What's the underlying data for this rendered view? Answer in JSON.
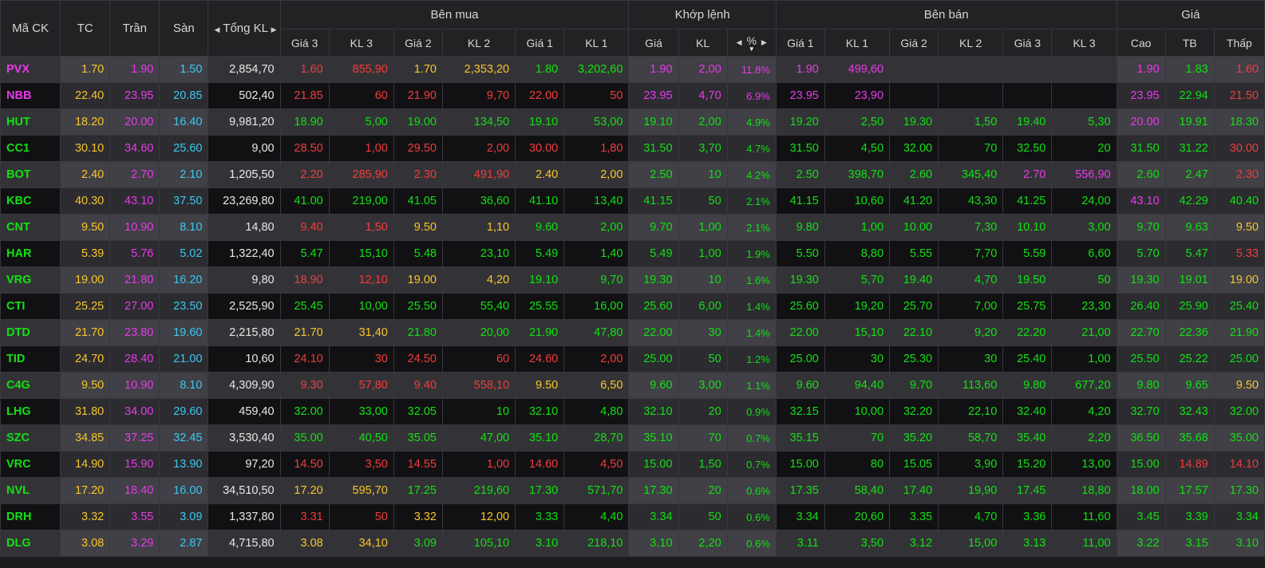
{
  "headers": {
    "top": {
      "symbol": "Mã CK",
      "ref": "TC",
      "ceil": "Trần",
      "floor": "Sàn",
      "total": "Tổng KL",
      "buy": "Bên mua",
      "match": "Khớp lệnh",
      "sell": "Bên bán",
      "price": "Giá"
    },
    "sub": {
      "p3": "Giá 3",
      "v3": "KL 3",
      "p2": "Giá 2",
      "v2": "KL 2",
      "p1": "Giá 1",
      "v1": "KL 1",
      "mp": "Giá",
      "mv": "KL",
      "pct": "%",
      "sp1": "Giá 1",
      "sv1": "KL 1",
      "sp2": "Giá 2",
      "sv2": "KL 2",
      "sp3": "Giá 3",
      "sv3": "KL 3",
      "high": "Cao",
      "avg": "TB",
      "low": "Thấp"
    }
  },
  "colors": {
    "r": "#f7c52b",
    "u": "#12e012",
    "d": "#f13c3c",
    "c": "#e83ae8",
    "f": "#3dc7ee"
  },
  "rows": [
    {
      "sym": [
        "PVX",
        "c"
      ],
      "ref": "1.70",
      "ceil": "1.90",
      "floor": "1.50",
      "total": "2,854,70",
      "b3": [
        "1.60",
        "855,90",
        "d"
      ],
      "b2": [
        "1.70",
        "2,353,20",
        "r"
      ],
      "b1": [
        "1.80",
        "3,202,60",
        "u"
      ],
      "m": [
        "1.90",
        "2,00",
        "c"
      ],
      "pct": "11.8%",
      "s1": [
        "1.90",
        "499,60",
        "c"
      ],
      "s2": [
        "",
        "",
        "u"
      ],
      "s3": [
        "",
        "",
        "u"
      ],
      "hi": [
        "1.90",
        "c"
      ],
      "avg": [
        "1.83",
        "u"
      ],
      "lo": [
        "1.60",
        "d"
      ]
    },
    {
      "sym": [
        "NBB",
        "c"
      ],
      "ref": "22.40",
      "ceil": "23.95",
      "floor": "20.85",
      "total": "502,40",
      "b3": [
        "21.85",
        "60",
        "d"
      ],
      "b2": [
        "21.90",
        "9,70",
        "d"
      ],
      "b1": [
        "22.00",
        "50",
        "d"
      ],
      "m": [
        "23.95",
        "4,70",
        "c"
      ],
      "pct": "6.9%",
      "s1": [
        "23.95",
        "23,90",
        "c"
      ],
      "s2": [
        "",
        "",
        "u"
      ],
      "s3": [
        "",
        "",
        "u"
      ],
      "hi": [
        "23.95",
        "c"
      ],
      "avg": [
        "22.94",
        "u"
      ],
      "lo": [
        "21.50",
        "d"
      ]
    },
    {
      "sym": [
        "HUT",
        "u"
      ],
      "ref": "18.20",
      "ceil": "20.00",
      "floor": "16.40",
      "total": "9,981,20",
      "b3": [
        "18.90",
        "5,00",
        "u"
      ],
      "b2": [
        "19.00",
        "134,50",
        "u"
      ],
      "b1": [
        "19.10",
        "53,00",
        "u"
      ],
      "m": [
        "19.10",
        "2,00",
        "u"
      ],
      "pct": "4.9%",
      "s1": [
        "19.20",
        "2,50",
        "u"
      ],
      "s2": [
        "19.30",
        "1,50",
        "u"
      ],
      "s3": [
        "19.40",
        "5,30",
        "u"
      ],
      "hi": [
        "20.00",
        "c"
      ],
      "avg": [
        "19.91",
        "u"
      ],
      "lo": [
        "18.30",
        "u"
      ]
    },
    {
      "sym": [
        "CC1",
        "u"
      ],
      "ref": "30.10",
      "ceil": "34.60",
      "floor": "25.60",
      "total": "9,00",
      "b3": [
        "28.50",
        "1,00",
        "d"
      ],
      "b2": [
        "29.50",
        "2,00",
        "d"
      ],
      "b1": [
        "30.00",
        "1,80",
        "d"
      ],
      "m": [
        "31.50",
        "3,70",
        "u"
      ],
      "pct": "4.7%",
      "s1": [
        "31.50",
        "4,50",
        "u"
      ],
      "s2": [
        "32.00",
        "70",
        "u"
      ],
      "s3": [
        "32.50",
        "20",
        "u"
      ],
      "hi": [
        "31.50",
        "u"
      ],
      "avg": [
        "31.22",
        "u"
      ],
      "lo": [
        "30.00",
        "d"
      ]
    },
    {
      "sym": [
        "BOT",
        "u"
      ],
      "ref": "2.40",
      "ceil": "2.70",
      "floor": "2.10",
      "total": "1,205,50",
      "b3": [
        "2.20",
        "285,90",
        "d"
      ],
      "b2": [
        "2.30",
        "491,90",
        "d"
      ],
      "b1": [
        "2.40",
        "2,00",
        "r"
      ],
      "m": [
        "2.50",
        "10",
        "u"
      ],
      "pct": "4.2%",
      "s1": [
        "2.50",
        "398,70",
        "u"
      ],
      "s2": [
        "2.60",
        "345,40",
        "u"
      ],
      "s3": [
        "2.70",
        "556,90",
        "c"
      ],
      "hi": [
        "2.60",
        "u"
      ],
      "avg": [
        "2.47",
        "u"
      ],
      "lo": [
        "2.30",
        "d"
      ]
    },
    {
      "sym": [
        "KBC",
        "u"
      ],
      "ref": "40.30",
      "ceil": "43.10",
      "floor": "37.50",
      "total": "23,269,80",
      "b3": [
        "41.00",
        "219,00",
        "u"
      ],
      "b2": [
        "41.05",
        "36,60",
        "u"
      ],
      "b1": [
        "41.10",
        "13,40",
        "u"
      ],
      "m": [
        "41.15",
        "50",
        "u"
      ],
      "pct": "2.1%",
      "s1": [
        "41.15",
        "10,60",
        "u"
      ],
      "s2": [
        "41.20",
        "43,30",
        "u"
      ],
      "s3": [
        "41.25",
        "24,00",
        "u"
      ],
      "hi": [
        "43.10",
        "c"
      ],
      "avg": [
        "42.29",
        "u"
      ],
      "lo": [
        "40.40",
        "u"
      ]
    },
    {
      "sym": [
        "CNT",
        "u"
      ],
      "ref": "9.50",
      "ceil": "10.90",
      "floor": "8.10",
      "total": "14,80",
      "b3": [
        "9.40",
        "1,50",
        "d"
      ],
      "b2": [
        "9.50",
        "1,10",
        "r"
      ],
      "b1": [
        "9.60",
        "2,00",
        "u"
      ],
      "m": [
        "9.70",
        "1,00",
        "u"
      ],
      "pct": "2.1%",
      "s1": [
        "9.80",
        "1,00",
        "u"
      ],
      "s2": [
        "10.00",
        "7,30",
        "u"
      ],
      "s3": [
        "10.10",
        "3,00",
        "u"
      ],
      "hi": [
        "9.70",
        "u"
      ],
      "avg": [
        "9.63",
        "u"
      ],
      "lo": [
        "9.50",
        "r"
      ]
    },
    {
      "sym": [
        "HAR",
        "u"
      ],
      "ref": "5.39",
      "ceil": "5.76",
      "floor": "5.02",
      "total": "1,322,40",
      "b3": [
        "5.47",
        "15,10",
        "u"
      ],
      "b2": [
        "5.48",
        "23,10",
        "u"
      ],
      "b1": [
        "5.49",
        "1,40",
        "u"
      ],
      "m": [
        "5.49",
        "1,00",
        "u"
      ],
      "pct": "1.9%",
      "s1": [
        "5.50",
        "8,80",
        "u"
      ],
      "s2": [
        "5.55",
        "7,70",
        "u"
      ],
      "s3": [
        "5.59",
        "6,60",
        "u"
      ],
      "hi": [
        "5.70",
        "u"
      ],
      "avg": [
        "5.47",
        "u"
      ],
      "lo": [
        "5.33",
        "d"
      ]
    },
    {
      "sym": [
        "VRG",
        "u"
      ],
      "ref": "19.00",
      "ceil": "21.80",
      "floor": "16.20",
      "total": "9,80",
      "b3": [
        "18.90",
        "12,10",
        "d"
      ],
      "b2": [
        "19.00",
        "4,20",
        "r"
      ],
      "b1": [
        "19.10",
        "9,70",
        "u"
      ],
      "m": [
        "19.30",
        "10",
        "u"
      ],
      "pct": "1.6%",
      "s1": [
        "19.30",
        "5,70",
        "u"
      ],
      "s2": [
        "19.40",
        "4,70",
        "u"
      ],
      "s3": [
        "19.50",
        "50",
        "u"
      ],
      "hi": [
        "19.30",
        "u"
      ],
      "avg": [
        "19.01",
        "u"
      ],
      "lo": [
        "19.00",
        "r"
      ]
    },
    {
      "sym": [
        "CTI",
        "u"
      ],
      "ref": "25.25",
      "ceil": "27.00",
      "floor": "23.50",
      "total": "2,525,90",
      "b3": [
        "25.45",
        "10,00",
        "u"
      ],
      "b2": [
        "25.50",
        "55,40",
        "u"
      ],
      "b1": [
        "25.55",
        "16,00",
        "u"
      ],
      "m": [
        "25.60",
        "6,00",
        "u"
      ],
      "pct": "1.4%",
      "s1": [
        "25.60",
        "19,20",
        "u"
      ],
      "s2": [
        "25.70",
        "7,00",
        "u"
      ],
      "s3": [
        "25.75",
        "23,30",
        "u"
      ],
      "hi": [
        "26.40",
        "u"
      ],
      "avg": [
        "25.90",
        "u"
      ],
      "lo": [
        "25.40",
        "u"
      ]
    },
    {
      "sym": [
        "DTD",
        "u"
      ],
      "ref": "21.70",
      "ceil": "23.80",
      "floor": "19.60",
      "total": "2,215,80",
      "b3": [
        "21.70",
        "31,40",
        "r"
      ],
      "b2": [
        "21.80",
        "20,00",
        "u"
      ],
      "b1": [
        "21.90",
        "47,80",
        "u"
      ],
      "m": [
        "22.00",
        "30",
        "u"
      ],
      "pct": "1.4%",
      "s1": [
        "22.00",
        "15,10",
        "u"
      ],
      "s2": [
        "22.10",
        "9,20",
        "u"
      ],
      "s3": [
        "22.20",
        "21,00",
        "u"
      ],
      "hi": [
        "22.70",
        "u"
      ],
      "avg": [
        "22.36",
        "u"
      ],
      "lo": [
        "21.90",
        "u"
      ]
    },
    {
      "sym": [
        "TID",
        "u"
      ],
      "ref": "24.70",
      "ceil": "28.40",
      "floor": "21.00",
      "total": "10,60",
      "b3": [
        "24.10",
        "30",
        "d"
      ],
      "b2": [
        "24.50",
        "60",
        "d"
      ],
      "b1": [
        "24.60",
        "2,00",
        "d"
      ],
      "m": [
        "25.00",
        "50",
        "u"
      ],
      "pct": "1.2%",
      "s1": [
        "25.00",
        "30",
        "u"
      ],
      "s2": [
        "25.30",
        "30",
        "u"
      ],
      "s3": [
        "25.40",
        "1,00",
        "u"
      ],
      "hi": [
        "25.50",
        "u"
      ],
      "avg": [
        "25.22",
        "u"
      ],
      "lo": [
        "25.00",
        "u"
      ]
    },
    {
      "sym": [
        "C4G",
        "u"
      ],
      "ref": "9.50",
      "ceil": "10.90",
      "floor": "8.10",
      "total": "4,309,90",
      "b3": [
        "9.30",
        "57,80",
        "d"
      ],
      "b2": [
        "9.40",
        "558,10",
        "d"
      ],
      "b1": [
        "9.50",
        "6,50",
        "r"
      ],
      "m": [
        "9.60",
        "3,00",
        "u"
      ],
      "pct": "1.1%",
      "s1": [
        "9.60",
        "94,40",
        "u"
      ],
      "s2": [
        "9.70",
        "113,60",
        "u"
      ],
      "s3": [
        "9.80",
        "677,20",
        "u"
      ],
      "hi": [
        "9.80",
        "u"
      ],
      "avg": [
        "9.65",
        "u"
      ],
      "lo": [
        "9.50",
        "r"
      ]
    },
    {
      "sym": [
        "LHG",
        "u"
      ],
      "ref": "31.80",
      "ceil": "34.00",
      "floor": "29.60",
      "total": "459,40",
      "b3": [
        "32.00",
        "33,00",
        "u"
      ],
      "b2": [
        "32.05",
        "10",
        "u"
      ],
      "b1": [
        "32.10",
        "4,80",
        "u"
      ],
      "m": [
        "32.10",
        "20",
        "u"
      ],
      "pct": "0.9%",
      "s1": [
        "32.15",
        "10,00",
        "u"
      ],
      "s2": [
        "32.20",
        "22,10",
        "u"
      ],
      "s3": [
        "32.40",
        "4,20",
        "u"
      ],
      "hi": [
        "32.70",
        "u"
      ],
      "avg": [
        "32.43",
        "u"
      ],
      "lo": [
        "32.00",
        "u"
      ]
    },
    {
      "sym": [
        "SZC",
        "u"
      ],
      "ref": "34.85",
      "ceil": "37.25",
      "floor": "32.45",
      "total": "3,530,40",
      "b3": [
        "35.00",
        "40,50",
        "u"
      ],
      "b2": [
        "35.05",
        "47,00",
        "u"
      ],
      "b1": [
        "35.10",
        "28,70",
        "u"
      ],
      "m": [
        "35.10",
        "70",
        "u"
      ],
      "pct": "0.7%",
      "s1": [
        "35.15",
        "70",
        "u"
      ],
      "s2": [
        "35.20",
        "58,70",
        "u"
      ],
      "s3": [
        "35.40",
        "2,20",
        "u"
      ],
      "hi": [
        "36.50",
        "u"
      ],
      "avg": [
        "35.68",
        "u"
      ],
      "lo": [
        "35.00",
        "u"
      ]
    },
    {
      "sym": [
        "VRC",
        "u"
      ],
      "ref": "14.90",
      "ceil": "15.90",
      "floor": "13.90",
      "total": "97,20",
      "b3": [
        "14.50",
        "3,50",
        "d"
      ],
      "b2": [
        "14.55",
        "1,00",
        "d"
      ],
      "b1": [
        "14.60",
        "4,50",
        "d"
      ],
      "m": [
        "15.00",
        "1,50",
        "u"
      ],
      "pct": "0.7%",
      "s1": [
        "15.00",
        "80",
        "u"
      ],
      "s2": [
        "15.05",
        "3,90",
        "u"
      ],
      "s3": [
        "15.20",
        "13,00",
        "u"
      ],
      "hi": [
        "15.00",
        "u"
      ],
      "avg": [
        "14.89",
        "d"
      ],
      "lo": [
        "14.10",
        "d"
      ]
    },
    {
      "sym": [
        "NVL",
        "u"
      ],
      "ref": "17.20",
      "ceil": "18.40",
      "floor": "16.00",
      "total": "34,510,50",
      "b3": [
        "17.20",
        "595,70",
        "r"
      ],
      "b2": [
        "17.25",
        "219,60",
        "u"
      ],
      "b1": [
        "17.30",
        "571,70",
        "u"
      ],
      "m": [
        "17.30",
        "20",
        "u"
      ],
      "pct": "0.6%",
      "s1": [
        "17.35",
        "58,40",
        "u"
      ],
      "s2": [
        "17.40",
        "19,90",
        "u"
      ],
      "s3": [
        "17.45",
        "18,80",
        "u"
      ],
      "hi": [
        "18.00",
        "u"
      ],
      "avg": [
        "17.57",
        "u"
      ],
      "lo": [
        "17.30",
        "u"
      ]
    },
    {
      "sym": [
        "DRH",
        "u"
      ],
      "ref": "3.32",
      "ceil": "3.55",
      "floor": "3.09",
      "total": "1,337,80",
      "b3": [
        "3.31",
        "50",
        "d"
      ],
      "b2": [
        "3.32",
        "12,00",
        "r"
      ],
      "b1": [
        "3.33",
        "4,40",
        "u"
      ],
      "m": [
        "3.34",
        "50",
        "u"
      ],
      "pct": "0.6%",
      "s1": [
        "3.34",
        "20,60",
        "u"
      ],
      "s2": [
        "3.35",
        "4,70",
        "u"
      ],
      "s3": [
        "3.36",
        "11,60",
        "u"
      ],
      "hi": [
        "3.45",
        "u"
      ],
      "avg": [
        "3.39",
        "u"
      ],
      "lo": [
        "3.34",
        "u"
      ]
    },
    {
      "sym": [
        "DLG",
        "u"
      ],
      "ref": "3.08",
      "ceil": "3.29",
      "floor": "2.87",
      "total": "4,715,80",
      "b3": [
        "3.08",
        "34,10",
        "r"
      ],
      "b2": [
        "3.09",
        "105,10",
        "u"
      ],
      "b1": [
        "3.10",
        "218,10",
        "u"
      ],
      "m": [
        "3.10",
        "2,20",
        "u"
      ],
      "pct": "0.6%",
      "s1": [
        "3.11",
        "3,50",
        "u"
      ],
      "s2": [
        "3.12",
        "15,00",
        "u"
      ],
      "s3": [
        "3.13",
        "11,00",
        "u"
      ],
      "hi": [
        "3.22",
        "u"
      ],
      "avg": [
        "3.15",
        "u"
      ],
      "lo": [
        "3.10",
        "u"
      ]
    }
  ]
}
